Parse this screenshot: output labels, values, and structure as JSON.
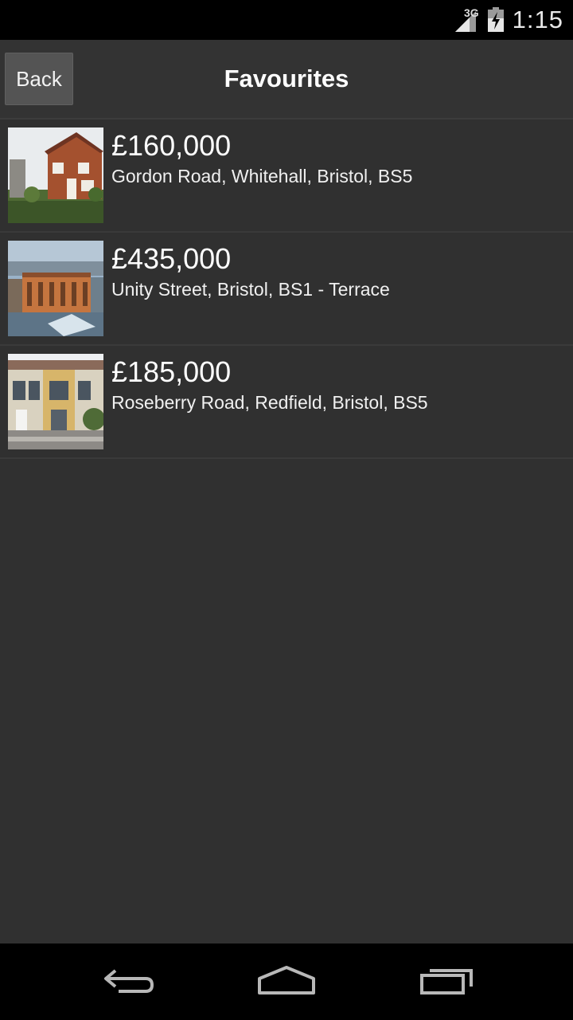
{
  "status_bar": {
    "network": "3G",
    "time": "1:15"
  },
  "header": {
    "back_label": "Back",
    "title": "Favourites"
  },
  "listings": [
    {
      "price": "£160,000",
      "address": "Gordon Road, Whitehall, Bristol, BS5"
    },
    {
      "price": "£435,000",
      "address": "Unity Street, Bristol, BS1 - Terrace"
    },
    {
      "price": "£185,000",
      "address": "Roseberry Road, Redfield, Bristol, BS5"
    }
  ],
  "nav_icons": [
    "back-icon",
    "home-icon",
    "recent-apps-icon"
  ]
}
